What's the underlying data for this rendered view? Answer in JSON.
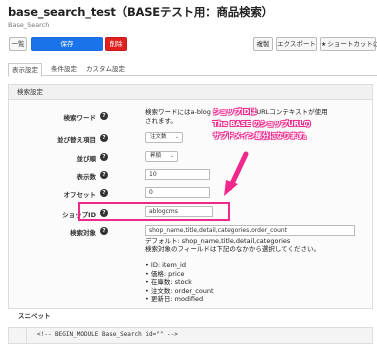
{
  "header": {
    "title": "base_search_test（BASEテスト用：商品検索）",
    "subtitle": "Base_Search"
  },
  "toolbar": {
    "list_label": "一覧",
    "save_label": "保存",
    "delete_label": "削除",
    "copy_label": "複製",
    "export_label": "エクスポート",
    "shortcut_label": "ショートカットに追加",
    "save_color": "#1a73e8",
    "delete_color": "#e02020"
  },
  "tabs": [
    {
      "label": "表示設定",
      "active": true
    },
    {
      "label": "条件設定",
      "active": false
    },
    {
      "label": "カスタム設定",
      "active": false
    }
  ],
  "panel": {
    "title": "検索設定"
  },
  "form": {
    "keyword": {
      "label": "検索ワード",
      "desc_line1": "検索ワードにはa-blog",
      "desc_line1_tail": "ドURLコンテキストが使用",
      "desc_line2": "されます。"
    },
    "sort_item": {
      "label": "並び替え項目",
      "value": "注文数"
    },
    "sort_order": {
      "label": "並び順",
      "value": "昇順"
    },
    "count": {
      "label": "表示数",
      "value": "10"
    },
    "offset": {
      "label": "オフセット",
      "value": "0"
    },
    "shop_id": {
      "label": "ショップID",
      "value": "ablogcms"
    },
    "search_target": {
      "label": "検索対象",
      "value": "shop_name,title,detail,categories,order_count",
      "default_line": "デフォルト: shop_name,title,detail,categories",
      "hint_line": "検索対象のフィールドは下記のなかから選択してください。",
      "fields": [
        "ID: item_id",
        "価格: price",
        "在庫数: stock",
        "注文数: order_count",
        "更新日: modified"
      ]
    }
  },
  "callout": {
    "line1": "ショップIDは",
    "line2": "The BASE のショップURLの",
    "line3": "サブドメイン部分になります。",
    "color": "#f0288c"
  },
  "snippet": {
    "title": "スニペット",
    "code_line": "<!-- BEGIN_MODULE Base_Search id=\"\" -->"
  }
}
